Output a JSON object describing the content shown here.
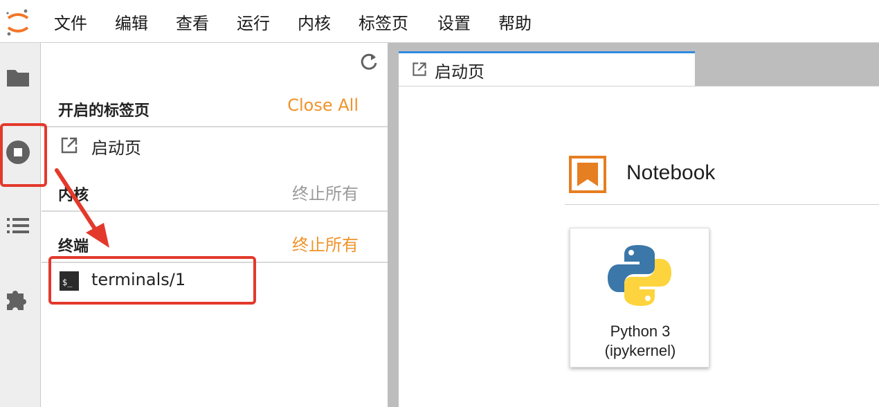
{
  "menubar": {
    "items": [
      "文件",
      "编辑",
      "查看",
      "运行",
      "内核",
      "标签页",
      "设置",
      "帮助"
    ]
  },
  "activitybar": {
    "icons": [
      "folder-icon",
      "running-stop-icon",
      "toc-list-icon",
      "extension-puzzle-icon"
    ]
  },
  "sidepanel": {
    "open_tabs": {
      "title": "开启的标签页",
      "action": "Close All",
      "items": [
        {
          "label": "启动页",
          "icon": "launcher-external-icon"
        }
      ]
    },
    "kernels": {
      "title": "内核",
      "action": "终止所有"
    },
    "terminals": {
      "title": "终端",
      "action": "终止所有",
      "items": [
        {
          "label": "terminals/1",
          "icon": "terminal-icon"
        }
      ]
    }
  },
  "main": {
    "tab": {
      "label": "启动页",
      "icon": "launcher-external-icon"
    },
    "launcher": {
      "section_title": "Notebook",
      "card": {
        "line1": "Python 3",
        "line2": "(ipykernel)"
      }
    }
  },
  "colors": {
    "accent_orange": "#f0932b",
    "tab_accent_blue": "#2f8ae0",
    "annotation_red": "#e3392b",
    "notebook_orange": "#e67e22"
  }
}
